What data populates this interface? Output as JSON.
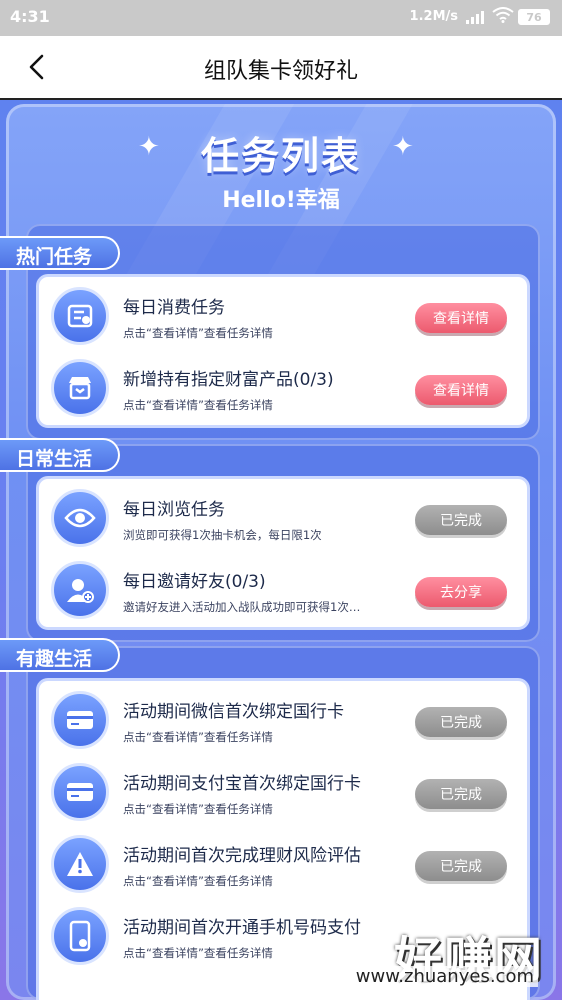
{
  "status_bar": {
    "time": "4:31",
    "net_speed": "1.2M/s",
    "battery": "76"
  },
  "header": {
    "title": "组队集卡领好礼"
  },
  "banner": {
    "title": "任务列表",
    "subtitle": "Hello!幸福"
  },
  "sections": [
    {
      "label": "热门任务",
      "tasks": [
        {
          "name": "每日消费任务",
          "desc": "点击“查看详情”查看任务详情",
          "button": "查看详情",
          "icon": "receipt-icon"
        },
        {
          "name": "新增持有指定财富产品(0/3)",
          "desc": "点击“查看详情”查看任务详情",
          "button": "查看详情",
          "icon": "store-icon"
        }
      ]
    },
    {
      "label": "日常生活",
      "tasks": [
        {
          "name": "每日浏览任务",
          "desc": "浏览即可获得1次抽卡机会，每日限1次",
          "button": "已完成",
          "icon": "eye-icon"
        },
        {
          "name": "每日邀请好友(0/3)",
          "desc": "邀请好友进入活动加入战队成功即可获得1次…",
          "button": "去分享",
          "icon": "add-user-icon"
        }
      ]
    },
    {
      "label": "有趣生活",
      "tasks": [
        {
          "name": "活动期间微信首次绑定国行卡",
          "desc": "点击“查看详情”查看任务详情",
          "button": "已完成",
          "icon": "card-icon"
        },
        {
          "name": "活动期间支付宝首次绑定国行卡",
          "desc": "点击“查看详情”查看任务详情",
          "button": "已完成",
          "icon": "card-icon"
        },
        {
          "name": "活动期间首次完成理财风险评估",
          "desc": "点击“查看详情”查看任务详情",
          "button": "已完成",
          "icon": "warning-icon"
        },
        {
          "name": "活动期间首次开通手机号码支付",
          "desc": "点击“查看详情”查看任务详情",
          "button": "",
          "icon": "phone-pay-icon"
        }
      ]
    }
  ],
  "watermark": {
    "text": "好赚网",
    "url": "www.zhuanyes.com"
  },
  "colors": {
    "accent_pink": "#ec5a6e",
    "completed_gray": "#8d8d8d",
    "panel_blue": "#6f90f3"
  }
}
